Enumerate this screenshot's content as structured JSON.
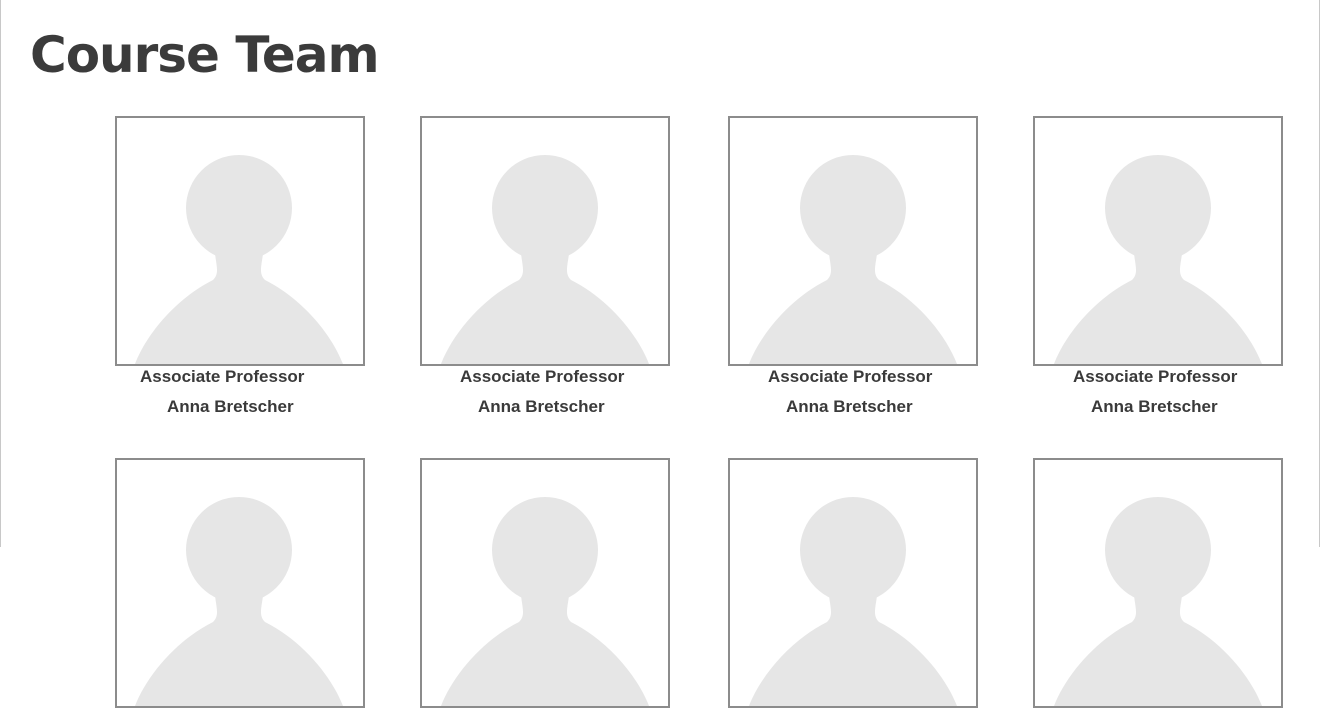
{
  "page": {
    "title": "Course Team"
  },
  "team": [
    {
      "role": "Associate Professor",
      "name": "Anna Bretscher",
      "photo_icon": "person-placeholder-icon"
    },
    {
      "role": "Associate Professor",
      "name": "Anna Bretscher",
      "photo_icon": "person-placeholder-icon"
    },
    {
      "role": "Associate Professor",
      "name": "Anna Bretscher",
      "photo_icon": "person-placeholder-icon"
    },
    {
      "role": "Associate Professor",
      "name": "Anna Bretscher",
      "photo_icon": "person-placeholder-icon"
    },
    {
      "role": "",
      "name": "",
      "photo_icon": "person-placeholder-icon"
    },
    {
      "role": "",
      "name": "",
      "photo_icon": "person-placeholder-icon"
    },
    {
      "role": "",
      "name": "",
      "photo_icon": "person-placeholder-icon"
    },
    {
      "role": "",
      "name": "",
      "photo_icon": "person-placeholder-icon"
    }
  ],
  "colors": {
    "text": "#3a3a3a",
    "photo_border": "#8c8c8c",
    "silhouette": "#e6e6e6"
  }
}
